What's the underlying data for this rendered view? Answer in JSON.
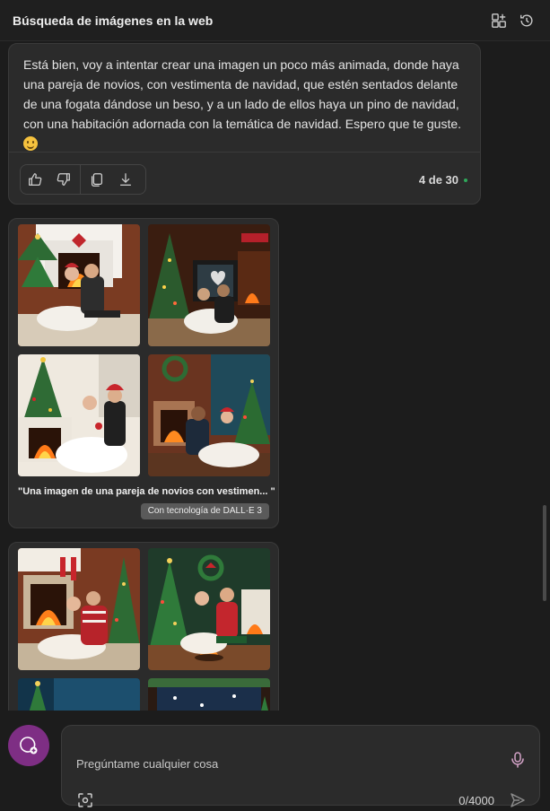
{
  "header": {
    "title": "Búsqueda de imágenes en la web"
  },
  "message": {
    "text": "Está bien, voy a intentar crear una imagen un poco más animada, donde haya una pareja de novios, con vestimenta de navidad, que estén sentados delante de una fogata dándose un beso, y a un lado de ellos haya un pino de navidad, con una habitación adornada con la temática de navidad. Espero que te guste.",
    "emoji": "smiling-face-emoji",
    "counter": "4 de 30"
  },
  "actions": [
    {
      "name": "like",
      "icon": "thumbs-up-icon"
    },
    {
      "name": "dislike",
      "icon": "thumbs-down-icon"
    },
    {
      "name": "copy",
      "icon": "copy-icon"
    },
    {
      "name": "download",
      "icon": "download-icon"
    }
  ],
  "image_sets": [
    {
      "caption": "\"Una imagen de una pareja de novios con vestimen... \"",
      "badge": "Con tecnología de DALL·E 3",
      "images": [
        "image-1",
        "image-2",
        "image-3",
        "image-4"
      ]
    },
    {
      "images": [
        "image-5",
        "image-6",
        "image-7",
        "image-8"
      ]
    }
  ],
  "composer": {
    "placeholder": "Pregúntame cualquier cosa",
    "char_count": "0/4000"
  },
  "colors": {
    "background": "#1c1c1c",
    "card": "#2b2b2b",
    "accent_avatar": "#7e2e84",
    "status_dot": "#2fa85a"
  }
}
